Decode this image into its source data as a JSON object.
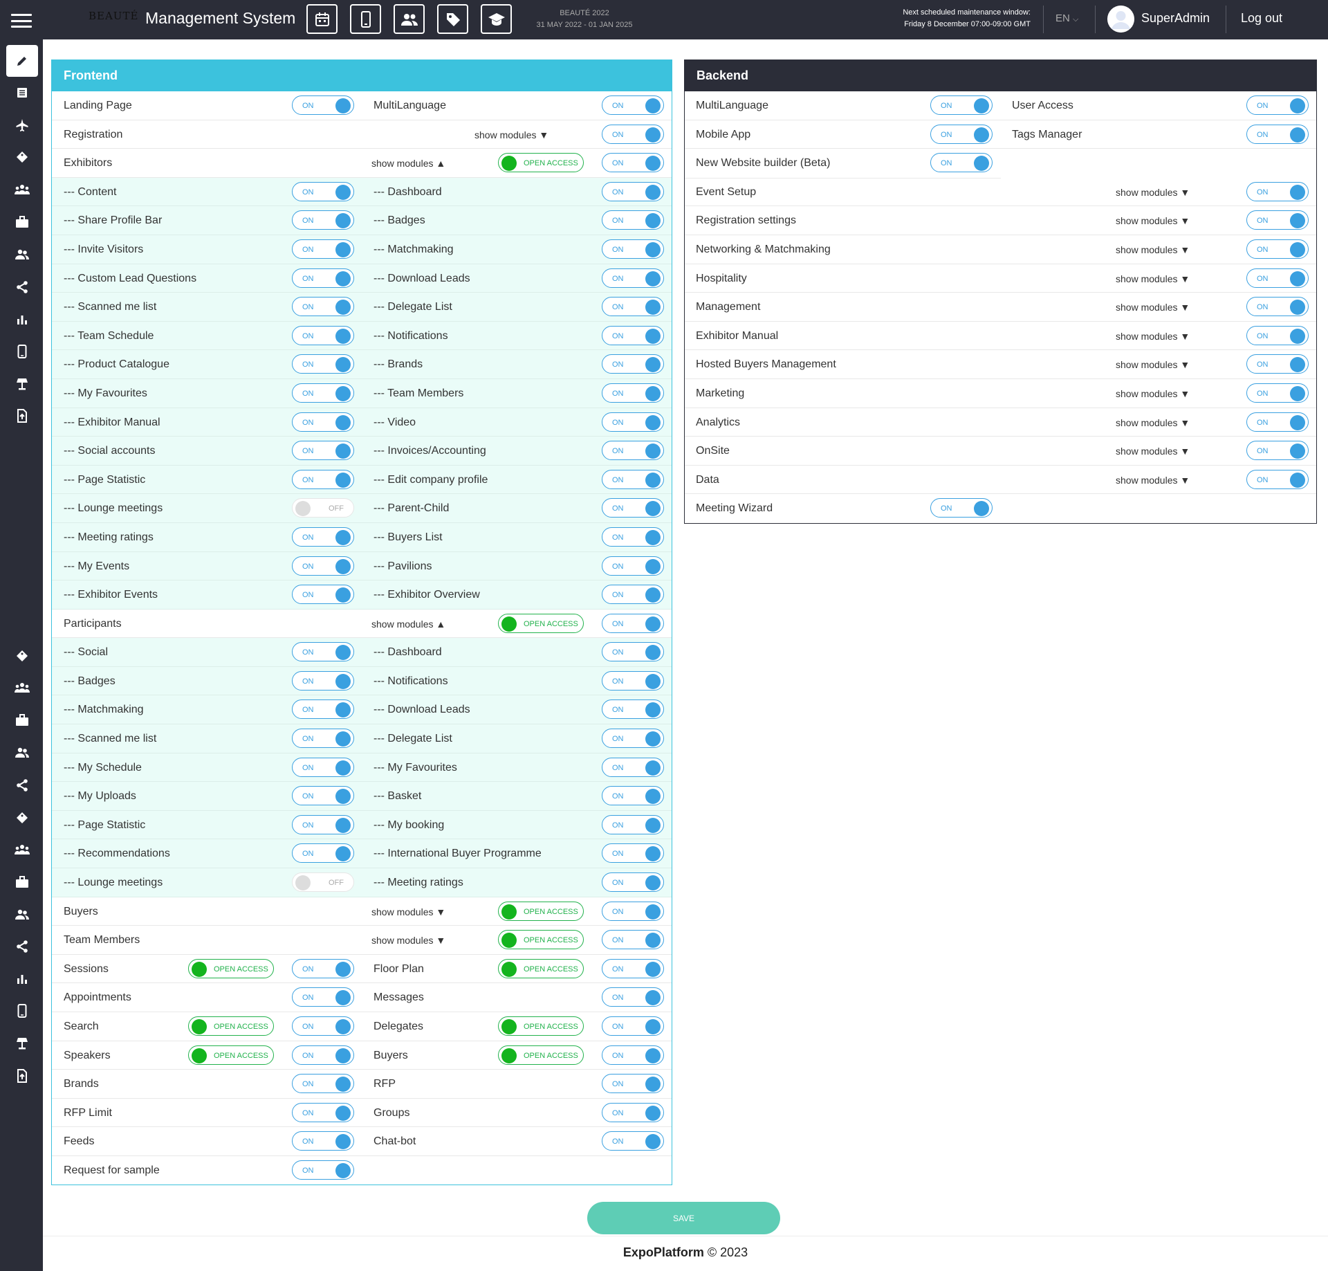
{
  "app": {
    "logo": "BEAUTÉ",
    "title": "Management System",
    "event_name": "BEAUTÉ 2022",
    "event_dates": "31 MAY 2022 - 01 JAN 2025",
    "maintenance_line1": "Next scheduled maintenance window:",
    "maintenance_line2": "Friday 8 December 07:00-09:00 GMT",
    "language": "EN",
    "user": "SuperAdmin",
    "logout": "Log out"
  },
  "toolbar_icons": [
    "calendar-icon",
    "mobile-icon",
    "users-icon",
    "tag-icon",
    "graduation-cap-icon"
  ],
  "sidebar_icons": [
    "pencil-icon",
    "list-icon",
    "plane-icon",
    "tag-icon",
    "group-icon",
    "briefcase-icon",
    "users-icon",
    "share-icon",
    "bar-chart-icon",
    "mobile-icon",
    "lamp-icon",
    "upload-file-icon",
    "tag-icon",
    "group-icon",
    "briefcase-icon",
    "users-icon",
    "share-icon",
    "tag-icon",
    "group-icon",
    "briefcase-icon",
    "users-icon",
    "share-icon",
    "bar-chart-icon",
    "mobile-icon",
    "lamp-icon",
    "upload-file-icon"
  ],
  "labels": {
    "on": "ON",
    "off": "OFF",
    "open_access": "OPEN ACCESS",
    "show_modules_down": "show modules ▼",
    "show_modules_up": "show modules ▲"
  },
  "frontend": {
    "title": "Frontend",
    "rows": [
      {
        "tint": false,
        "c1": {
          "label": "Landing Page",
          "toggle": "on"
        },
        "c2": {
          "label": "MultiLanguage",
          "toggle": "on"
        }
      },
      {
        "tint": false,
        "c1": {
          "label": "Registration"
        },
        "c2": {
          "show": "down",
          "show_right": true,
          "toggle": "on"
        }
      },
      {
        "tint": false,
        "c1": {
          "label": "Exhibitors"
        },
        "c2": {
          "show": "up",
          "open": true,
          "toggle": "on"
        }
      },
      {
        "tint": true,
        "c1": {
          "label": "--- Content",
          "toggle": "on"
        },
        "c2": {
          "label": "--- Dashboard",
          "toggle": "on"
        }
      },
      {
        "tint": true,
        "c1": {
          "label": "--- Share Profile Bar",
          "toggle": "on"
        },
        "c2": {
          "label": "--- Badges",
          "toggle": "on"
        }
      },
      {
        "tint": true,
        "c1": {
          "label": "--- Invite Visitors",
          "toggle": "on"
        },
        "c2": {
          "label": "--- Matchmaking",
          "toggle": "on"
        }
      },
      {
        "tint": true,
        "c1": {
          "label": "--- Custom Lead Questions",
          "toggle": "on"
        },
        "c2": {
          "label": "--- Download Leads",
          "toggle": "on"
        }
      },
      {
        "tint": true,
        "c1": {
          "label": "--- Scanned me list",
          "toggle": "on"
        },
        "c2": {
          "label": "--- Delegate List",
          "toggle": "on"
        }
      },
      {
        "tint": true,
        "c1": {
          "label": "--- Team Schedule",
          "toggle": "on"
        },
        "c2": {
          "label": "--- Notifications",
          "toggle": "on"
        }
      },
      {
        "tint": true,
        "c1": {
          "label": "--- Product Catalogue",
          "toggle": "on"
        },
        "c2": {
          "label": "--- Brands",
          "toggle": "on"
        }
      },
      {
        "tint": true,
        "c1": {
          "label": "--- My Favourites",
          "toggle": "on"
        },
        "c2": {
          "label": "--- Team Members",
          "toggle": "on"
        }
      },
      {
        "tint": true,
        "c1": {
          "label": "--- Exhibitor Manual",
          "toggle": "on"
        },
        "c2": {
          "label": "--- Video",
          "toggle": "on"
        }
      },
      {
        "tint": true,
        "c1": {
          "label": "--- Social accounts",
          "toggle": "on"
        },
        "c2": {
          "label": "--- Invoices/Accounting",
          "toggle": "on"
        }
      },
      {
        "tint": true,
        "c1": {
          "label": "--- Page Statistic",
          "toggle": "on"
        },
        "c2": {
          "label": "--- Edit company profile",
          "toggle": "on"
        }
      },
      {
        "tint": true,
        "c1": {
          "label": "--- Lounge meetings",
          "toggle": "off"
        },
        "c2": {
          "label": "--- Parent-Child",
          "toggle": "on"
        }
      },
      {
        "tint": true,
        "c1": {
          "label": "--- Meeting ratings",
          "toggle": "on"
        },
        "c2": {
          "label": "--- Buyers List",
          "toggle": "on"
        }
      },
      {
        "tint": true,
        "c1": {
          "label": "--- My Events",
          "toggle": "on"
        },
        "c2": {
          "label": "--- Pavilions",
          "toggle": "on"
        }
      },
      {
        "tint": true,
        "c1": {
          "label": "--- Exhibitor Events",
          "toggle": "on"
        },
        "c2": {
          "label": "--- Exhibitor Overview",
          "toggle": "on"
        }
      },
      {
        "tint": false,
        "c1": {
          "label": "Participants"
        },
        "c2": {
          "show": "up",
          "open": true,
          "toggle": "on"
        }
      },
      {
        "tint": true,
        "c1": {
          "label": "--- Social",
          "toggle": "on"
        },
        "c2": {
          "label": "--- Dashboard",
          "toggle": "on"
        }
      },
      {
        "tint": true,
        "c1": {
          "label": "--- Badges",
          "toggle": "on"
        },
        "c2": {
          "label": "--- Notifications",
          "toggle": "on"
        }
      },
      {
        "tint": true,
        "c1": {
          "label": "--- Matchmaking",
          "toggle": "on"
        },
        "c2": {
          "label": "--- Download Leads",
          "toggle": "on"
        }
      },
      {
        "tint": true,
        "c1": {
          "label": "--- Scanned me list",
          "toggle": "on"
        },
        "c2": {
          "label": "--- Delegate List",
          "toggle": "on"
        }
      },
      {
        "tint": true,
        "c1": {
          "label": "--- My Schedule",
          "toggle": "on"
        },
        "c2": {
          "label": "--- My Favourites",
          "toggle": "on"
        }
      },
      {
        "tint": true,
        "c1": {
          "label": "--- My Uploads",
          "toggle": "on"
        },
        "c2": {
          "label": "--- Basket",
          "toggle": "on"
        }
      },
      {
        "tint": true,
        "c1": {
          "label": "--- Page Statistic",
          "toggle": "on"
        },
        "c2": {
          "label": "--- My booking",
          "toggle": "on"
        }
      },
      {
        "tint": true,
        "c1": {
          "label": "--- Recommendations",
          "toggle": "on"
        },
        "c2": {
          "label": "--- International Buyer Programme",
          "toggle": "on"
        }
      },
      {
        "tint": true,
        "c1": {
          "label": "--- Lounge meetings",
          "toggle": "off"
        },
        "c2": {
          "label": "--- Meeting ratings",
          "toggle": "on"
        }
      },
      {
        "tint": false,
        "c1": {
          "label": "Buyers"
        },
        "c2": {
          "show": "down",
          "open": true,
          "toggle": "on"
        }
      },
      {
        "tint": false,
        "c1": {
          "label": "Team Members"
        },
        "c2": {
          "show": "down",
          "open": true,
          "toggle": "on"
        }
      },
      {
        "tint": false,
        "c1": {
          "label": "Sessions",
          "open": true,
          "toggle": "on"
        },
        "c2": {
          "label": "Floor Plan",
          "open": true,
          "toggle": "on"
        }
      },
      {
        "tint": false,
        "c1": {
          "label": "Appointments",
          "toggle": "on"
        },
        "c2": {
          "label": "Messages",
          "toggle": "on"
        }
      },
      {
        "tint": false,
        "c1": {
          "label": "Search",
          "open": true,
          "toggle": "on"
        },
        "c2": {
          "label": "Delegates",
          "open": true,
          "toggle": "on"
        }
      },
      {
        "tint": false,
        "c1": {
          "label": "Speakers",
          "open": true,
          "toggle": "on"
        },
        "c2": {
          "label": "Buyers",
          "open": true,
          "toggle": "on"
        }
      },
      {
        "tint": false,
        "c1": {
          "label": "Brands",
          "toggle": "on"
        },
        "c2": {
          "label": "RFP",
          "toggle": "on"
        }
      },
      {
        "tint": false,
        "c1": {
          "label": "RFP Limit",
          "toggle": "on"
        },
        "c2": {
          "label": "Groups",
          "toggle": "on"
        }
      },
      {
        "tint": false,
        "c1": {
          "label": "Feeds",
          "toggle": "on"
        },
        "c2": {
          "label": "Chat-bot",
          "toggle": "on"
        }
      },
      {
        "tint": false,
        "c1": {
          "label": "Request for sample",
          "toggle": "on"
        },
        "c2": {}
      }
    ]
  },
  "backend": {
    "title": "Backend",
    "rows": [
      {
        "c1": {
          "label": "MultiLanguage",
          "toggle": "on"
        },
        "c2": {
          "label": "User Access",
          "toggle": "on"
        }
      },
      {
        "c1": {
          "label": "Mobile App",
          "toggle": "on"
        },
        "c2": {
          "label": "Tags Manager",
          "toggle": "on"
        }
      },
      {
        "c1": {
          "label": "New Website builder (Beta)",
          "toggle": "on"
        },
        "c2": {},
        "half": true
      },
      {
        "c1": {
          "label": "Event Setup"
        },
        "c2": {
          "show": "down",
          "toggle": "on"
        }
      },
      {
        "c1": {
          "label": "Registration settings"
        },
        "c2": {
          "show": "down",
          "toggle": "on"
        }
      },
      {
        "c1": {
          "label": "Networking & Matchmaking"
        },
        "c2": {
          "show": "down",
          "toggle": "on"
        }
      },
      {
        "c1": {
          "label": "Hospitality"
        },
        "c2": {
          "show": "down",
          "toggle": "on"
        }
      },
      {
        "c1": {
          "label": "Management"
        },
        "c2": {
          "show": "down",
          "toggle": "on"
        }
      },
      {
        "c1": {
          "label": "Exhibitor Manual"
        },
        "c2": {
          "show": "down",
          "toggle": "on"
        }
      },
      {
        "c1": {
          "label": "Hosted Buyers Management"
        },
        "c2": {
          "show": "down",
          "toggle": "on"
        }
      },
      {
        "c1": {
          "label": "Marketing"
        },
        "c2": {
          "show": "down",
          "toggle": "on"
        }
      },
      {
        "c1": {
          "label": "Analytics"
        },
        "c2": {
          "show": "down",
          "toggle": "on"
        }
      },
      {
        "c1": {
          "label": "OnSite"
        },
        "c2": {
          "show": "down",
          "toggle": "on"
        }
      },
      {
        "c1": {
          "label": "Data"
        },
        "c2": {
          "show": "down",
          "toggle": "on"
        }
      },
      {
        "c1": {
          "label": "Meeting Wizard",
          "toggle": "on"
        },
        "c2": {},
        "last": true
      }
    ]
  },
  "save_label": "SAVE",
  "footer": {
    "brand": "ExpoPlatform",
    "copyright": "© 2023"
  }
}
